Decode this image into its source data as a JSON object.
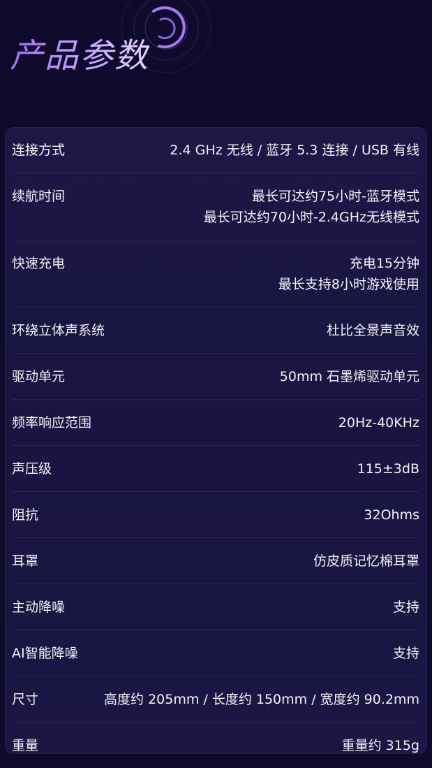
{
  "page": {
    "title": "产品参数"
  },
  "specs": [
    {
      "label": "连接方式",
      "values": [
        "2.4 GHz 无线 / 蓝牙 5.3 连接 / USB 有线"
      ]
    },
    {
      "label": "续航时间",
      "values": [
        "最长可达约75小时-蓝牙模式",
        "最长可达约70小时-2.4GHz无线模式"
      ]
    },
    {
      "label": "快速充电",
      "values": [
        "充电15分钟",
        "最长支持8小时游戏使用"
      ]
    },
    {
      "label": "环绕立体声系统",
      "values": [
        "杜比全景声音效"
      ]
    },
    {
      "label": "驱动单元",
      "values": [
        "50mm 石墨烯驱动单元"
      ]
    },
    {
      "label": "频率响应范围",
      "values": [
        "20Hz-40KHz"
      ]
    },
    {
      "label": "声压级",
      "values": [
        "115±3dB"
      ]
    },
    {
      "label": "阻抗",
      "values": [
        "32Ohms"
      ]
    },
    {
      "label": "耳罩",
      "values": [
        "仿皮质记忆棉耳罩"
      ]
    },
    {
      "label": "主动降噪",
      "values": [
        "支持"
      ]
    },
    {
      "label": "AI智能降噪",
      "values": [
        "支持"
      ]
    },
    {
      "label": "尺寸",
      "values": [
        "高度约 205mm / 长度约 150mm / 宽度约 90.2mm"
      ]
    },
    {
      "label": "重量",
      "values": [
        "重量约 315g"
      ]
    }
  ],
  "colors": {
    "background": "#0e0b2c",
    "card": "#1a1642",
    "title_gradient_start": "#a26bf0",
    "title_gradient_end": "#e4d4ff",
    "text": "#f4f3fa"
  }
}
